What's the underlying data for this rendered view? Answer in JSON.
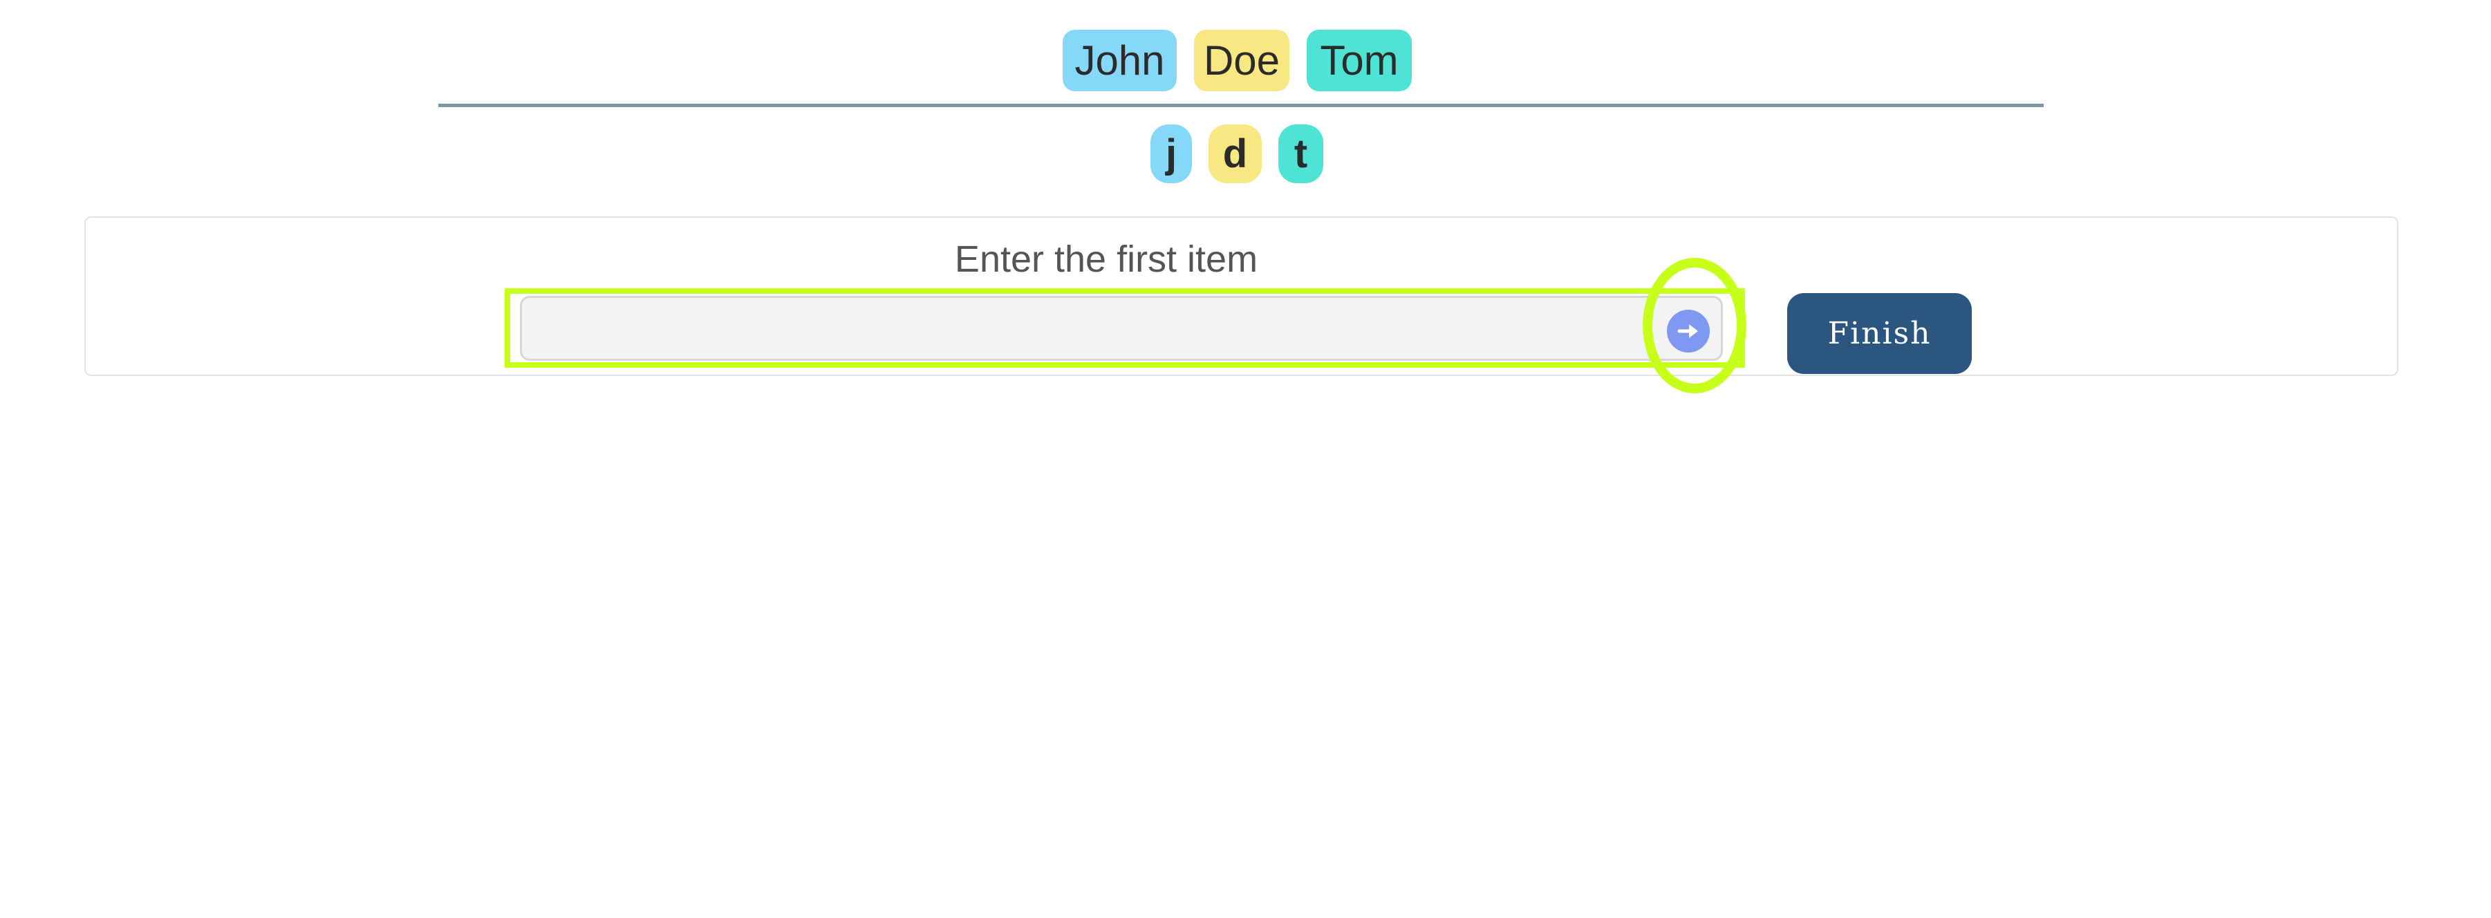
{
  "name_chips": [
    {
      "label": "John",
      "color": "#85d8f7"
    },
    {
      "label": "Doe",
      "color": "#f7e884"
    },
    {
      "label": "Tom",
      "color": "#4fe3d6"
    }
  ],
  "initial_chips": [
    {
      "label": "j",
      "color": "#85d8f7"
    },
    {
      "label": "d",
      "color": "#f7e884"
    },
    {
      "label": "t",
      "color": "#4fe3d6"
    }
  ],
  "entry": {
    "prompt": "Enter the first item",
    "input_value": "",
    "submit_icon": "arrow-right-icon"
  },
  "finish_label": "Finish",
  "colors": {
    "highlight": "#c6ff1a",
    "finish_button": "#2b5680",
    "submit_button": "#7f98f2",
    "divider": "#7a97a3"
  }
}
